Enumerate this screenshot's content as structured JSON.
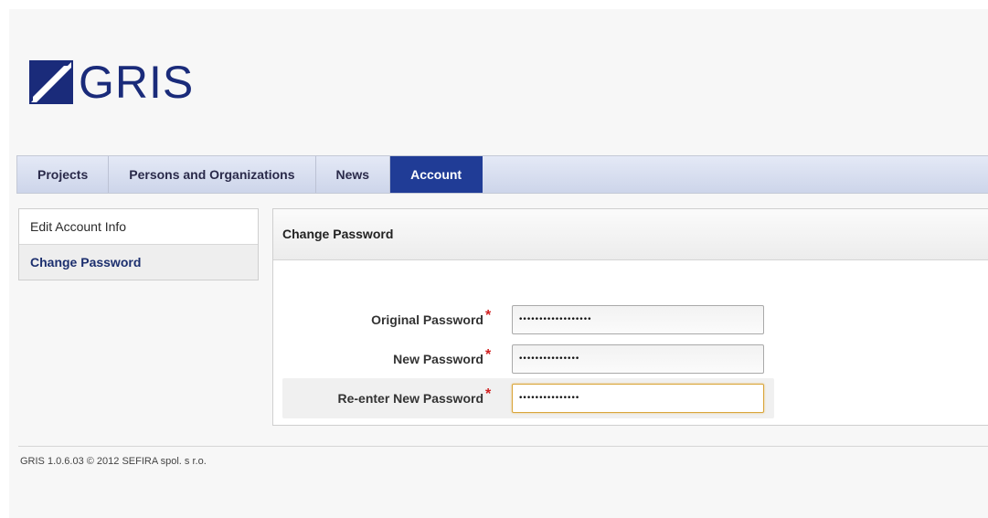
{
  "header": {
    "logo_text": "GRIS"
  },
  "nav": {
    "tabs": [
      {
        "label": "Projects"
      },
      {
        "label": "Persons and Organizations"
      },
      {
        "label": "News"
      },
      {
        "label": "Account"
      }
    ],
    "active_tab": "Account"
  },
  "sidebar": {
    "items": [
      {
        "label": "Edit Account Info"
      },
      {
        "label": "Change Password"
      }
    ],
    "active_item": "Change Password"
  },
  "panel": {
    "title": "Change Password",
    "fields": [
      {
        "label": "Original Password",
        "required_mark": "*",
        "value": "••••••••••••••••••"
      },
      {
        "label": "New Password",
        "required_mark": "*",
        "value": "•••••••••••••••"
      },
      {
        "label": "Re-enter New Password",
        "required_mark": "*",
        "value": "•••••••••••••••"
      }
    ]
  },
  "footer": {
    "text": "GRIS 1.0.6.03 © 2012 SEFIRA spol. s r.o."
  },
  "colors": {
    "brand": "#1a2b7a",
    "active_tab": "#203c96",
    "required": "#d02020",
    "focus_border": "#d9a53a"
  }
}
